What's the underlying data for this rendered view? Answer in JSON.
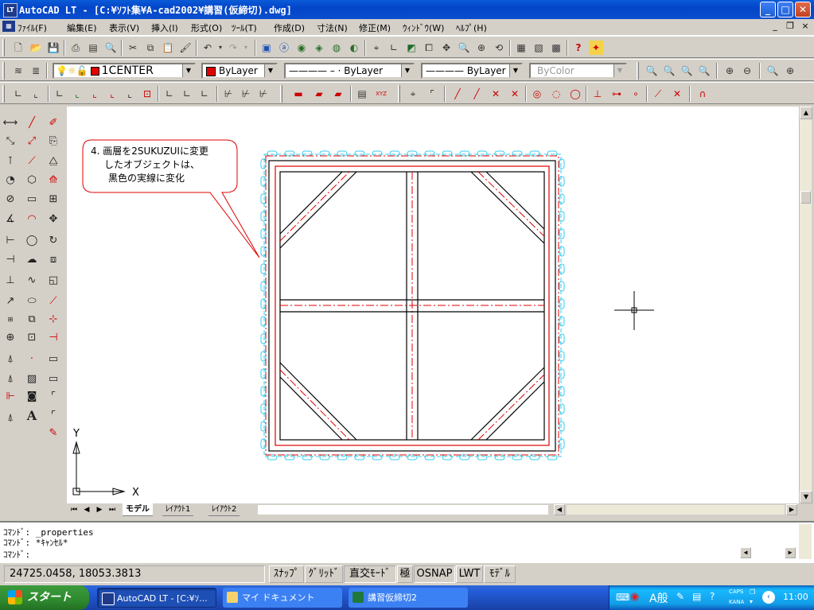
{
  "window": {
    "app_icon": "LT",
    "title": "AutoCAD LT - [C:¥ｿﾌﾄ集¥A-cad2002¥講習(仮締切).dwg]",
    "controls": {
      "minimize": "_",
      "maximize": "□",
      "close": "✕"
    },
    "mdi_controls": {
      "minimize": "_",
      "restore": "❐",
      "close": "×"
    }
  },
  "menu": {
    "items": [
      "ﾌｧｲﾙ(F)",
      "編集(E)",
      "表示(V)",
      "挿入(I)",
      "形式(O)",
      "ﾂｰﾙ(T)",
      "作成(D)",
      "寸法(N)",
      "修正(M)",
      "ｳｨﾝﾄﾞｳ(W)",
      "ﾍﾙﾌﾟ(H)"
    ]
  },
  "layers_toolbar": {
    "layer_name": "1CENTER",
    "color": "ByLayer",
    "linetype": "ByLayer",
    "linetype_sample": "———— – ·",
    "lineweight": "ByLayer",
    "lineweight_sample": "————",
    "plotstyle": "ByColor"
  },
  "callout": {
    "line1": "4. 画層を2SUKUZUIに変更",
    "line2": "したオブジェクトは、",
    "line3": "黒色の実線に変化"
  },
  "ucs": {
    "x_label": "X",
    "y_label": "Y"
  },
  "tabs": {
    "model": "モデル",
    "layout1": "ﾚｲｱｳﾄ1",
    "layout2": "ﾚｲｱｳﾄ2"
  },
  "command": {
    "line1": "ｺﾏﾝﾄﾞ: _properties",
    "line2": "ｺﾏﾝﾄﾞ: *ｷｬﾝｾﾙ*",
    "line3": "ｺﾏﾝﾄﾞ:"
  },
  "status": {
    "coords": "24725.0458, 18053.3813",
    "snap": "ｽﾅｯﾌﾟ",
    "grid": "ｸﾞﾘｯﾄﾞ",
    "ortho": "直交ﾓｰﾄﾞ",
    "polar": "極",
    "osnap": "OSNAP",
    "lwt": "LWT",
    "model": "ﾓﾃﾞﾙ"
  },
  "taskbar": {
    "start": "スタート",
    "items": [
      "AutoCAD LT - [C:¥ｿ...",
      "マイ ドキュメント",
      "講習仮締切2"
    ],
    "tray_caps": "CAPS",
    "tray_kana": "KANA",
    "ime": "A般",
    "clock": "11:00"
  },
  "colors": {
    "titlebar": "#0a5bd8",
    "red_line": "#e00000",
    "cyan_selection": "#33ccee",
    "taskbar": "#245edb",
    "start_green": "#3c9a3c"
  }
}
